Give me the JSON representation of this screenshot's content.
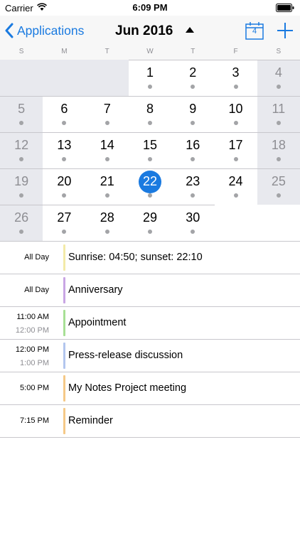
{
  "status_bar": {
    "carrier": "Carrier",
    "time": "6:09 PM"
  },
  "nav": {
    "back_label": "Applications",
    "month_title": "Jun 2016",
    "today_number": "4",
    "icons": {
      "back": "chevron-left-icon",
      "caret": "caret-up-icon",
      "today": "calendar-icon",
      "add": "plus-icon"
    }
  },
  "weekdays": [
    "S",
    "M",
    "T",
    "W",
    "T",
    "F",
    "S"
  ],
  "calendar": {
    "selected_day": "22",
    "weeks": [
      [
        "",
        "",
        "",
        "1",
        "2",
        "3",
        "4"
      ],
      [
        "5",
        "6",
        "7",
        "8",
        "9",
        "10",
        "11"
      ],
      [
        "12",
        "13",
        "14",
        "15",
        "16",
        "17",
        "18"
      ],
      [
        "19",
        "20",
        "21",
        "22",
        "23",
        "24",
        "25"
      ],
      [
        "26",
        "27",
        "28",
        "29",
        "30",
        "",
        ""
      ]
    ]
  },
  "events": [
    {
      "time": "All Day",
      "end": "",
      "title": "Sunrise: 04:50; sunset: 22:10",
      "color": "#f3eaa8"
    },
    {
      "time": "All Day",
      "end": "",
      "title": "Anniversary",
      "color": "#c9a6e4"
    },
    {
      "time": "11:00 AM",
      "end": "12:00 PM",
      "title": "Appointment",
      "color": "#a8e095"
    },
    {
      "time": "12:00 PM",
      "end": "1:00 PM",
      "title": "Press-release discussion",
      "color": "#b3c6ee"
    },
    {
      "time": "5:00 PM",
      "end": "",
      "title": "My Notes Project meeting",
      "color": "#f5c987"
    },
    {
      "time": "7:15 PM",
      "end": "",
      "title": "Reminder",
      "color": "#f5c987"
    }
  ],
  "colors": {
    "accent": "#1a7ae0",
    "grey_cell": "#e8e9ee",
    "dot": "#a3a4a7"
  }
}
